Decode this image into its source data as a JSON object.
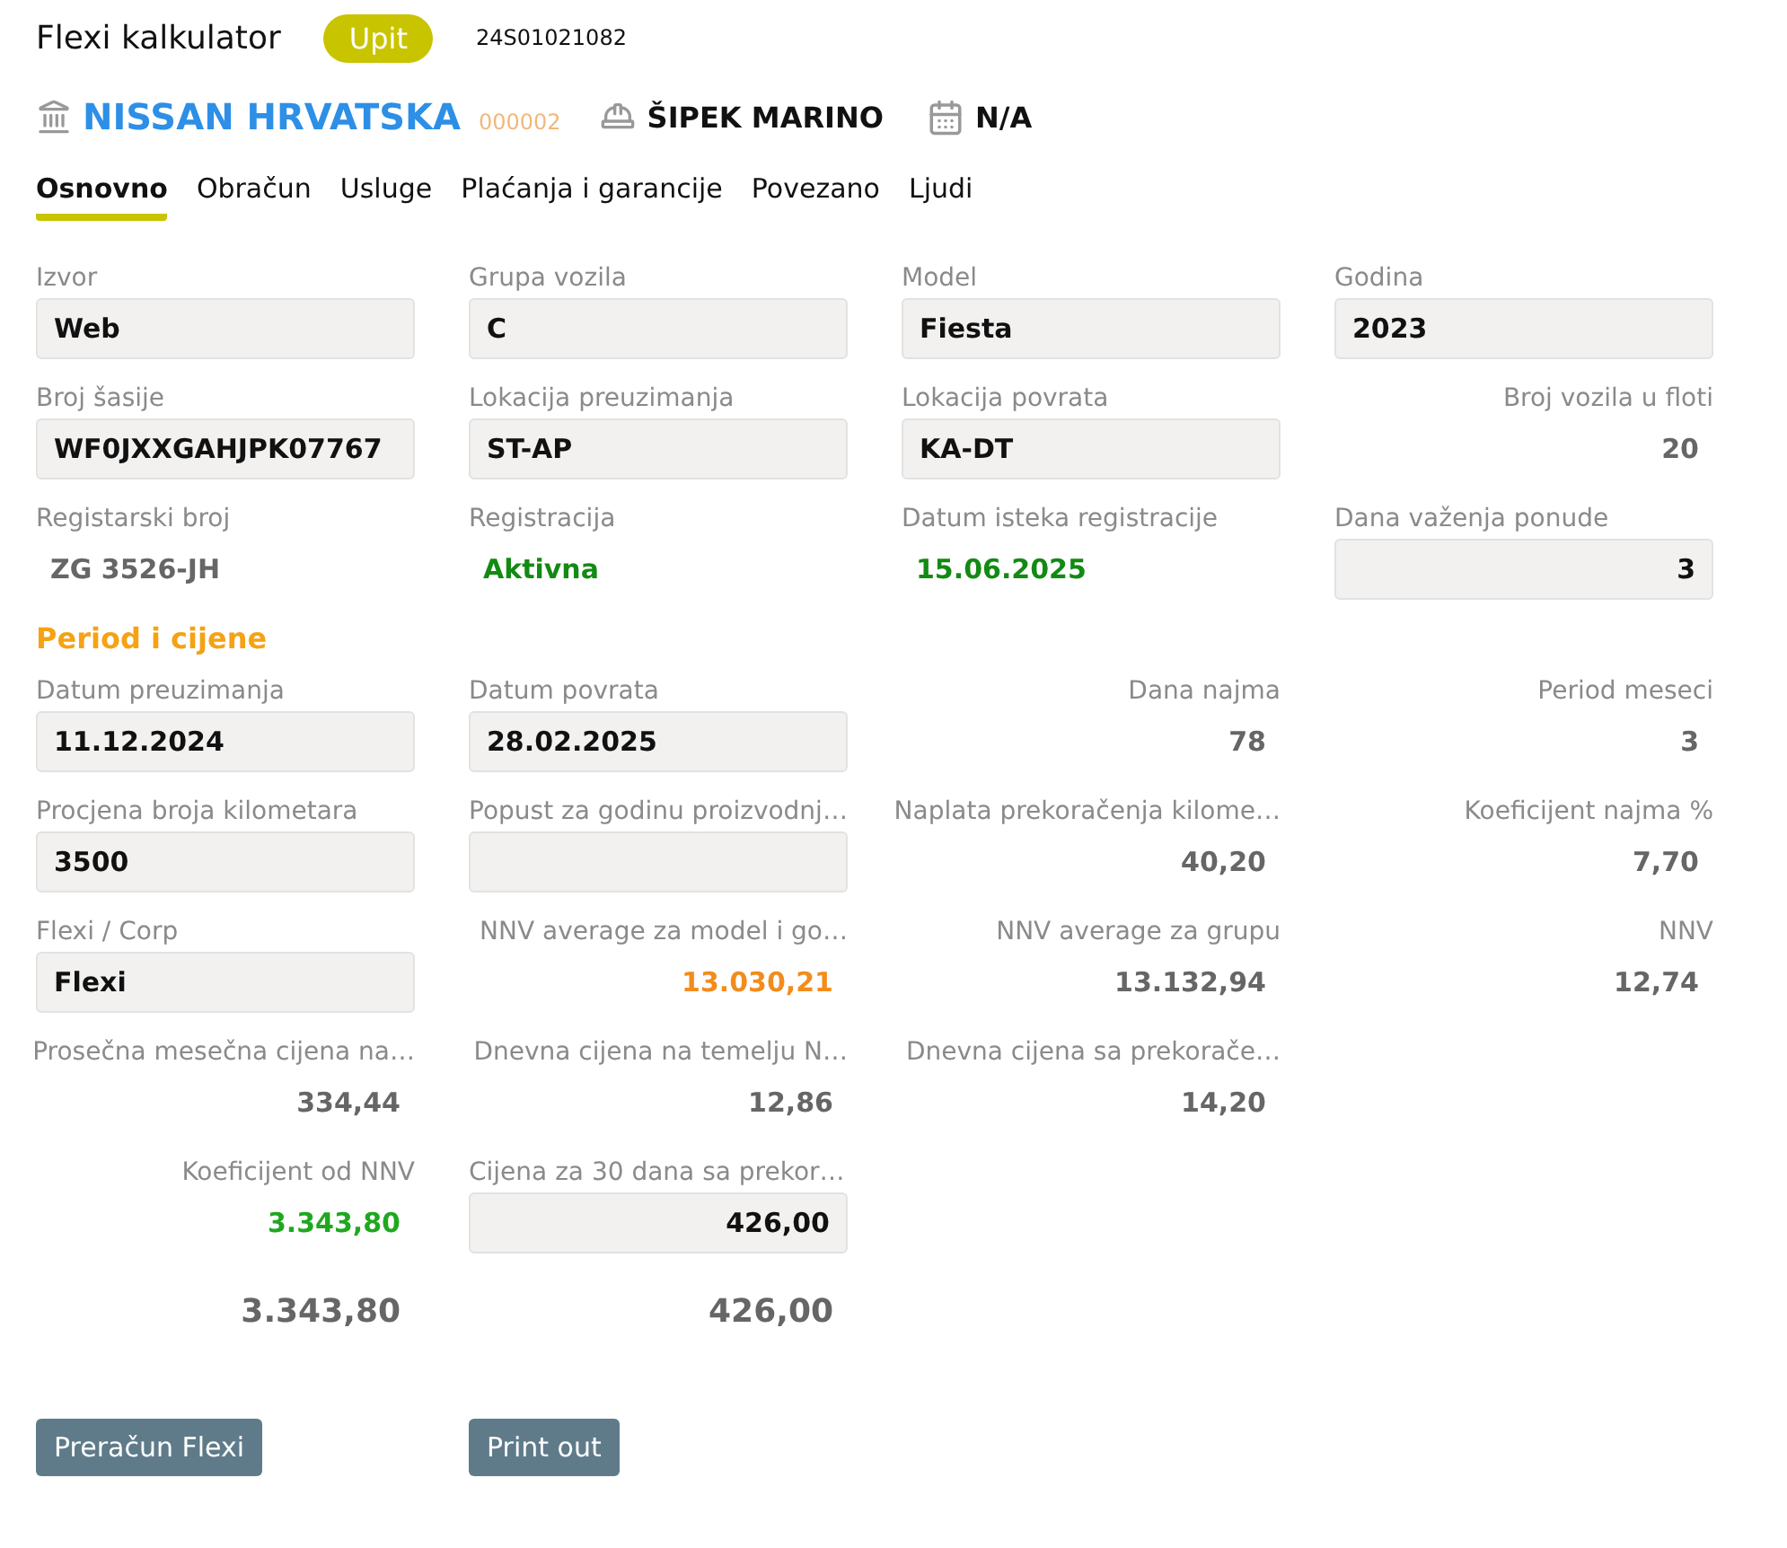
{
  "header": {
    "title": "Flexi kalkulator",
    "status": "Upit",
    "number": "24S01021082"
  },
  "entity": {
    "company": "NISSAN HRVATSKA",
    "code": "000002",
    "person": "ŠIPEK MARINO",
    "date": "N/A"
  },
  "tabs": [
    {
      "label": "Osnovno",
      "selected": true
    },
    {
      "label": "Obračun",
      "selected": false
    },
    {
      "label": "Usluge",
      "selected": false
    },
    {
      "label": "Plaćanja i garancije",
      "selected": false
    },
    {
      "label": "Povezano",
      "selected": false
    },
    {
      "label": "Ljudi",
      "selected": false
    }
  ],
  "sections": [
    {
      "rows": [
        [
          {
            "kind": "input",
            "label": "Izvor",
            "value": "Web"
          },
          {
            "kind": "input",
            "label": "Grupa vozila",
            "value": "C"
          },
          {
            "kind": "input",
            "label": "Model",
            "value": "Fiesta"
          },
          {
            "kind": "input",
            "label": "Godina",
            "value": "2023"
          }
        ],
        [
          {
            "kind": "input",
            "label": "Broj šasije",
            "value": "WF0JXXGAHJPK07767"
          },
          {
            "kind": "input",
            "label": "Lokacija preuzimanja",
            "value": "ST-AP"
          },
          {
            "kind": "input",
            "label": "Lokacija povrata",
            "value": "KA-DT"
          },
          {
            "kind": "number",
            "label": "Broj vozila u floti",
            "value": "20"
          }
        ],
        [
          {
            "kind": "text",
            "label": "Registarski broj",
            "value": "ZG 3526-JH"
          },
          {
            "kind": "text",
            "label": "Registracija",
            "value": "Aktivna",
            "color": "#138a13"
          },
          {
            "kind": "text",
            "label": "Datum isteka registracije",
            "value": "15.06.2025",
            "color": "#138a13"
          },
          {
            "kind": "number_input",
            "label": "Dana važenja ponude",
            "value": "3"
          }
        ]
      ]
    },
    {
      "title": "Period i cijene",
      "rows": [
        [
          {
            "kind": "input",
            "label": "Datum preuzimanja",
            "value": "11.12.2024"
          },
          {
            "kind": "input",
            "label": "Datum povrata",
            "value": "28.02.2025"
          },
          {
            "kind": "number",
            "label": "Dana najma",
            "value": "78"
          },
          {
            "kind": "number",
            "label": "Period meseci",
            "value": "3"
          }
        ],
        [
          {
            "kind": "input",
            "label": "Procjena broja kilometara",
            "value": "3500"
          },
          {
            "kind": "input",
            "label": "Popust za godinu proizvodnj…"
          },
          {
            "kind": "number",
            "label": "Naplata prekoračenja kilome…",
            "value": "40,20"
          },
          {
            "kind": "number",
            "label": "Koeficijent najma %",
            "value": "7,70"
          }
        ],
        [
          {
            "kind": "input",
            "label": "Flexi / Corp",
            "value": "Flexi"
          },
          {
            "kind": "number",
            "label": "NNV average za model i go…",
            "value": "13.030,21",
            "color": "#f28c1c"
          },
          {
            "kind": "number",
            "label": "NNV average za grupu",
            "value": "13.132,94"
          },
          {
            "kind": "number",
            "label": "NNV",
            "value": "12,74"
          }
        ],
        [
          {
            "kind": "number",
            "label": "Prosečna mesečna cijena na…",
            "value": "334,44"
          },
          {
            "kind": "number",
            "label": "Dnevna cijena na temelju N…",
            "value": "12,86"
          },
          {
            "kind": "number",
            "label": "Dnevna cijena sa prekorače…",
            "value": "14,20"
          }
        ],
        [
          {
            "kind": "number",
            "label": "Koeficijent od NNV",
            "value": "3.343,80",
            "color": "#1fa81f"
          },
          {
            "kind": "number_input",
            "label": "Cijena za 30 dana sa prekor…",
            "value": "426,00"
          }
        ],
        [
          {
            "kind": "total",
            "value": "3.343,80"
          },
          {
            "kind": "total",
            "value": "426,00"
          }
        ]
      ]
    }
  ],
  "buttons": [
    "Preračun Flexi",
    "Print out"
  ]
}
